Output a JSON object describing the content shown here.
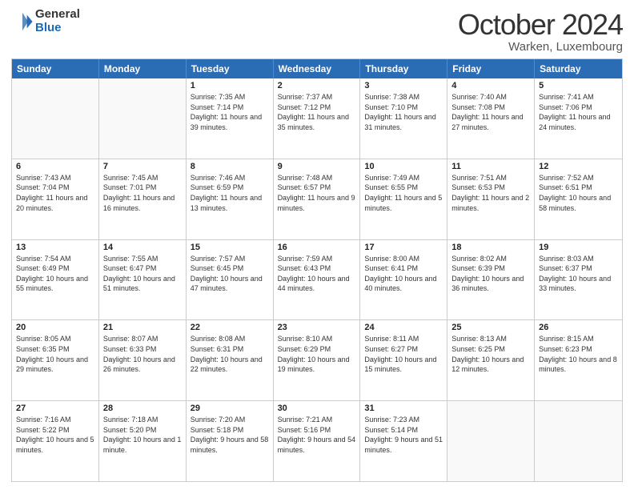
{
  "logo": {
    "general": "General",
    "blue": "Blue"
  },
  "title": "October 2024",
  "location": "Warken, Luxembourg",
  "header": {
    "days": [
      "Sunday",
      "Monday",
      "Tuesday",
      "Wednesday",
      "Thursday",
      "Friday",
      "Saturday"
    ]
  },
  "weeks": [
    [
      {
        "day": "",
        "empty": true
      },
      {
        "day": "",
        "empty": true
      },
      {
        "day": "1",
        "sunrise": "Sunrise: 7:35 AM",
        "sunset": "Sunset: 7:14 PM",
        "daylight": "Daylight: 11 hours and 39 minutes."
      },
      {
        "day": "2",
        "sunrise": "Sunrise: 7:37 AM",
        "sunset": "Sunset: 7:12 PM",
        "daylight": "Daylight: 11 hours and 35 minutes."
      },
      {
        "day": "3",
        "sunrise": "Sunrise: 7:38 AM",
        "sunset": "Sunset: 7:10 PM",
        "daylight": "Daylight: 11 hours and 31 minutes."
      },
      {
        "day": "4",
        "sunrise": "Sunrise: 7:40 AM",
        "sunset": "Sunset: 7:08 PM",
        "daylight": "Daylight: 11 hours and 27 minutes."
      },
      {
        "day": "5",
        "sunrise": "Sunrise: 7:41 AM",
        "sunset": "Sunset: 7:06 PM",
        "daylight": "Daylight: 11 hours and 24 minutes."
      }
    ],
    [
      {
        "day": "6",
        "sunrise": "Sunrise: 7:43 AM",
        "sunset": "Sunset: 7:04 PM",
        "daylight": "Daylight: 11 hours and 20 minutes."
      },
      {
        "day": "7",
        "sunrise": "Sunrise: 7:45 AM",
        "sunset": "Sunset: 7:01 PM",
        "daylight": "Daylight: 11 hours and 16 minutes."
      },
      {
        "day": "8",
        "sunrise": "Sunrise: 7:46 AM",
        "sunset": "Sunset: 6:59 PM",
        "daylight": "Daylight: 11 hours and 13 minutes."
      },
      {
        "day": "9",
        "sunrise": "Sunrise: 7:48 AM",
        "sunset": "Sunset: 6:57 PM",
        "daylight": "Daylight: 11 hours and 9 minutes."
      },
      {
        "day": "10",
        "sunrise": "Sunrise: 7:49 AM",
        "sunset": "Sunset: 6:55 PM",
        "daylight": "Daylight: 11 hours and 5 minutes."
      },
      {
        "day": "11",
        "sunrise": "Sunrise: 7:51 AM",
        "sunset": "Sunset: 6:53 PM",
        "daylight": "Daylight: 11 hours and 2 minutes."
      },
      {
        "day": "12",
        "sunrise": "Sunrise: 7:52 AM",
        "sunset": "Sunset: 6:51 PM",
        "daylight": "Daylight: 10 hours and 58 minutes."
      }
    ],
    [
      {
        "day": "13",
        "sunrise": "Sunrise: 7:54 AM",
        "sunset": "Sunset: 6:49 PM",
        "daylight": "Daylight: 10 hours and 55 minutes."
      },
      {
        "day": "14",
        "sunrise": "Sunrise: 7:55 AM",
        "sunset": "Sunset: 6:47 PM",
        "daylight": "Daylight: 10 hours and 51 minutes."
      },
      {
        "day": "15",
        "sunrise": "Sunrise: 7:57 AM",
        "sunset": "Sunset: 6:45 PM",
        "daylight": "Daylight: 10 hours and 47 minutes."
      },
      {
        "day": "16",
        "sunrise": "Sunrise: 7:59 AM",
        "sunset": "Sunset: 6:43 PM",
        "daylight": "Daylight: 10 hours and 44 minutes."
      },
      {
        "day": "17",
        "sunrise": "Sunrise: 8:00 AM",
        "sunset": "Sunset: 6:41 PM",
        "daylight": "Daylight: 10 hours and 40 minutes."
      },
      {
        "day": "18",
        "sunrise": "Sunrise: 8:02 AM",
        "sunset": "Sunset: 6:39 PM",
        "daylight": "Daylight: 10 hours and 36 minutes."
      },
      {
        "day": "19",
        "sunrise": "Sunrise: 8:03 AM",
        "sunset": "Sunset: 6:37 PM",
        "daylight": "Daylight: 10 hours and 33 minutes."
      }
    ],
    [
      {
        "day": "20",
        "sunrise": "Sunrise: 8:05 AM",
        "sunset": "Sunset: 6:35 PM",
        "daylight": "Daylight: 10 hours and 29 minutes."
      },
      {
        "day": "21",
        "sunrise": "Sunrise: 8:07 AM",
        "sunset": "Sunset: 6:33 PM",
        "daylight": "Daylight: 10 hours and 26 minutes."
      },
      {
        "day": "22",
        "sunrise": "Sunrise: 8:08 AM",
        "sunset": "Sunset: 6:31 PM",
        "daylight": "Daylight: 10 hours and 22 minutes."
      },
      {
        "day": "23",
        "sunrise": "Sunrise: 8:10 AM",
        "sunset": "Sunset: 6:29 PM",
        "daylight": "Daylight: 10 hours and 19 minutes."
      },
      {
        "day": "24",
        "sunrise": "Sunrise: 8:11 AM",
        "sunset": "Sunset: 6:27 PM",
        "daylight": "Daylight: 10 hours and 15 minutes."
      },
      {
        "day": "25",
        "sunrise": "Sunrise: 8:13 AM",
        "sunset": "Sunset: 6:25 PM",
        "daylight": "Daylight: 10 hours and 12 minutes."
      },
      {
        "day": "26",
        "sunrise": "Sunrise: 8:15 AM",
        "sunset": "Sunset: 6:23 PM",
        "daylight": "Daylight: 10 hours and 8 minutes."
      }
    ],
    [
      {
        "day": "27",
        "sunrise": "Sunrise: 7:16 AM",
        "sunset": "Sunset: 5:22 PM",
        "daylight": "Daylight: 10 hours and 5 minutes."
      },
      {
        "day": "28",
        "sunrise": "Sunrise: 7:18 AM",
        "sunset": "Sunset: 5:20 PM",
        "daylight": "Daylight: 10 hours and 1 minute."
      },
      {
        "day": "29",
        "sunrise": "Sunrise: 7:20 AM",
        "sunset": "Sunset: 5:18 PM",
        "daylight": "Daylight: 9 hours and 58 minutes."
      },
      {
        "day": "30",
        "sunrise": "Sunrise: 7:21 AM",
        "sunset": "Sunset: 5:16 PM",
        "daylight": "Daylight: 9 hours and 54 minutes."
      },
      {
        "day": "31",
        "sunrise": "Sunrise: 7:23 AM",
        "sunset": "Sunset: 5:14 PM",
        "daylight": "Daylight: 9 hours and 51 minutes."
      },
      {
        "day": "",
        "empty": true
      },
      {
        "day": "",
        "empty": true
      }
    ]
  ]
}
